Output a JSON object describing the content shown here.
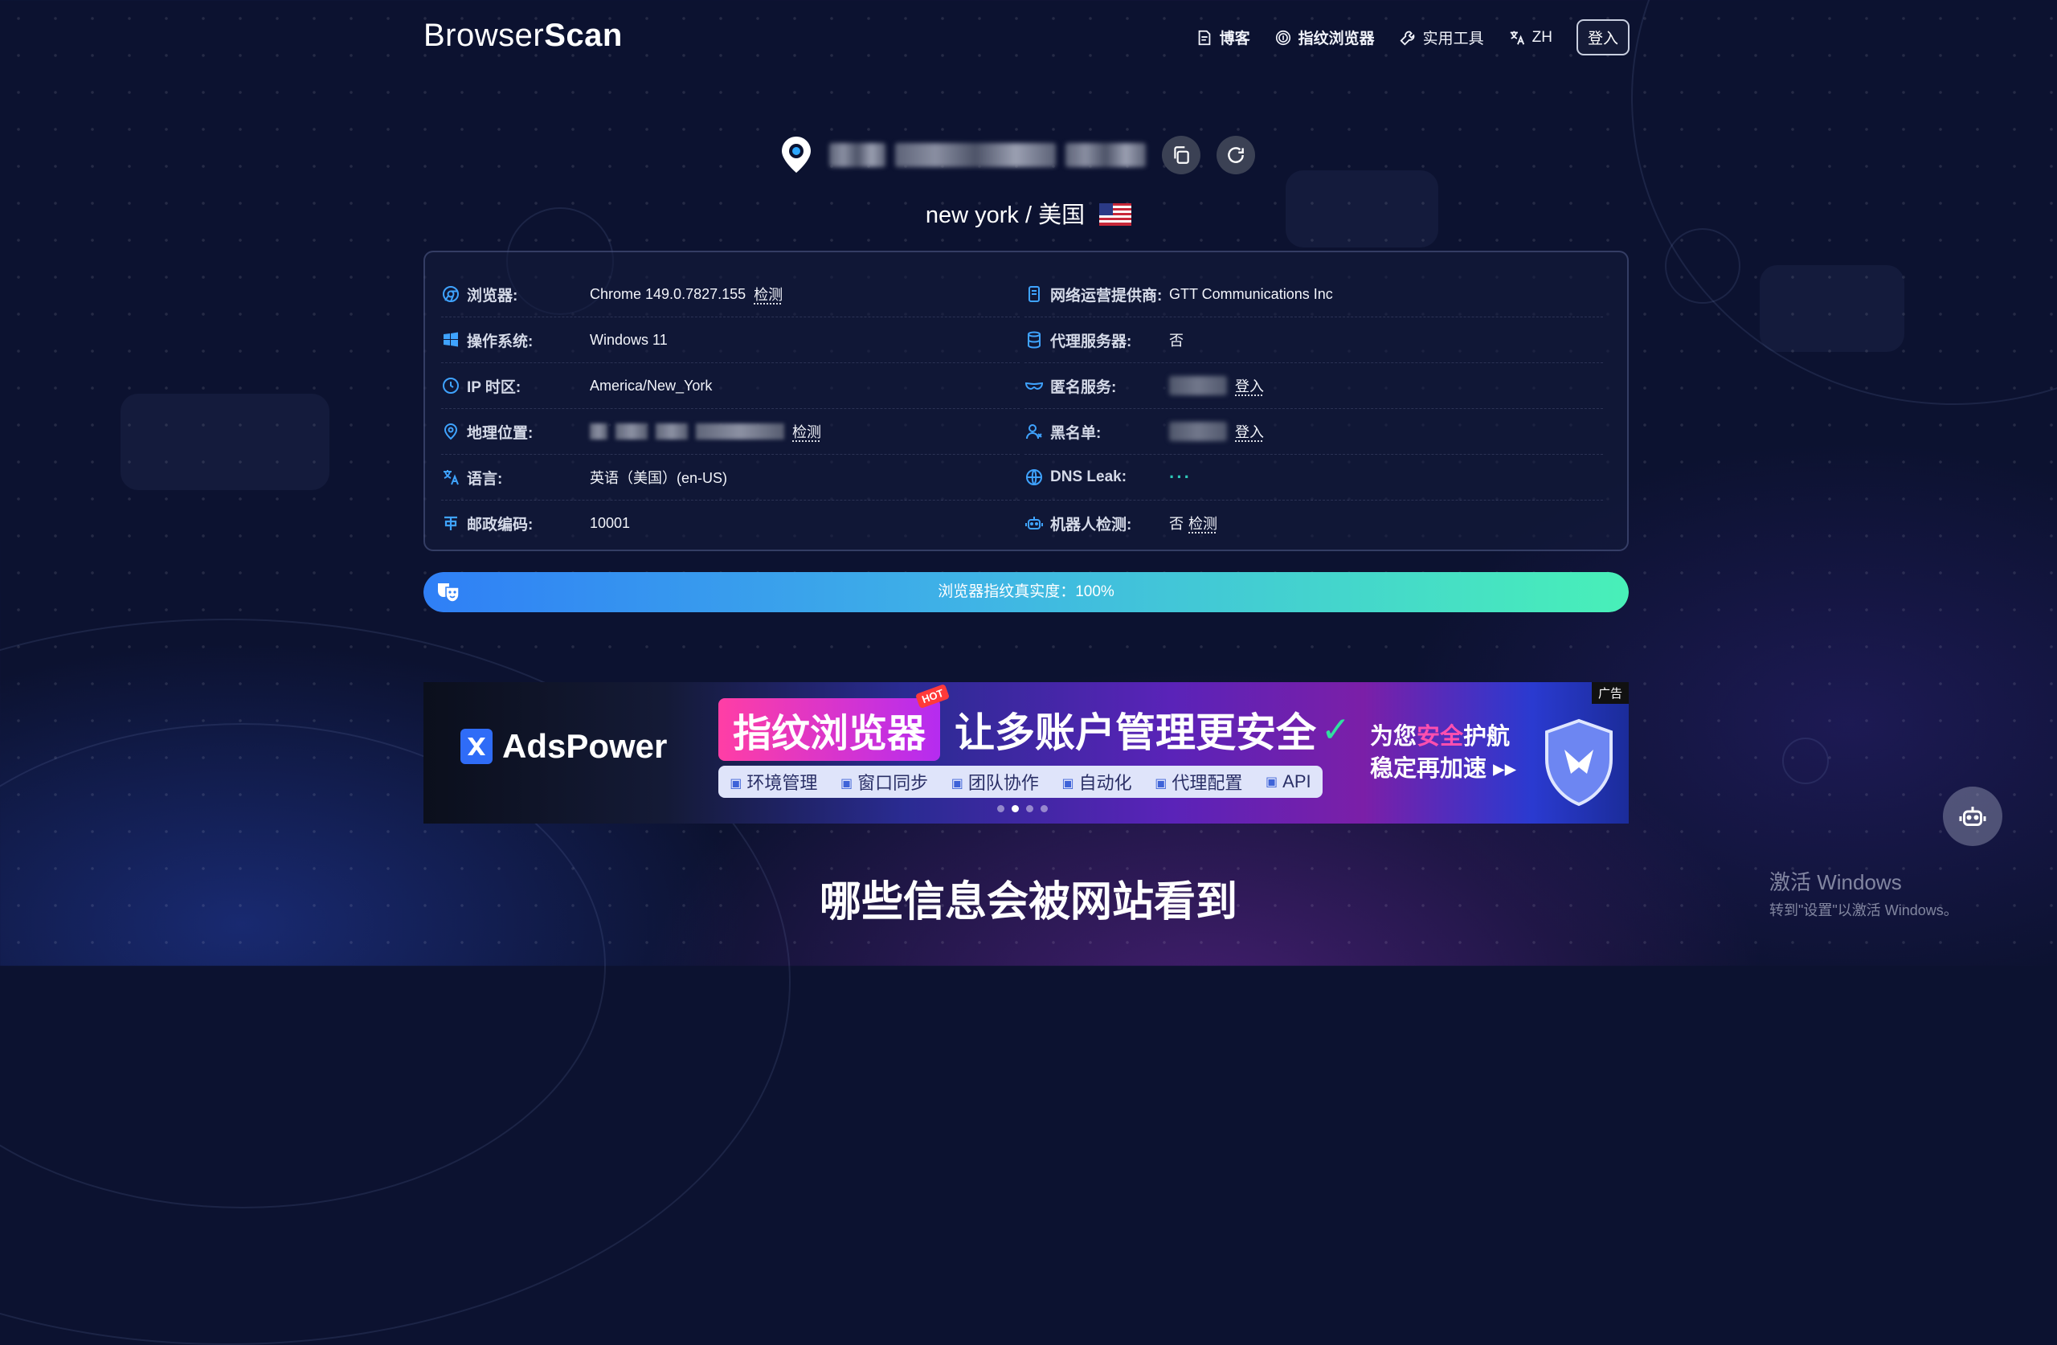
{
  "header": {
    "logo": {
      "part1": "Browser",
      "part2": "Scan"
    },
    "nav": [
      {
        "label": "博客"
      },
      {
        "label": "指纹浏览器"
      },
      {
        "label": "实用工具"
      },
      {
        "label": "ZH"
      }
    ],
    "login_label": "登入"
  },
  "ip": {
    "location": "new york / 美国"
  },
  "info": {
    "left": [
      {
        "label": "浏览器:",
        "value": "Chrome 149.0.7827.155",
        "link": "检测"
      },
      {
        "label": "操作系统:",
        "value": "Windows 11"
      },
      {
        "label": "IP 时区:",
        "value": "America/New_York"
      },
      {
        "label": "地理位置:",
        "link": "检测"
      },
      {
        "label": "语言:",
        "value": "英语（美国）(en-US)"
      },
      {
        "label": "邮政编码:",
        "value": "10001"
      }
    ],
    "right": [
      {
        "label": "网络运营提供商:",
        "value": "GTT Communications Inc"
      },
      {
        "label": "代理服务器:",
        "value": "否"
      },
      {
        "label": "匿名服务:",
        "link": "登入"
      },
      {
        "label": "黑名单:",
        "link": "登入"
      },
      {
        "label": "DNS Leak:",
        "value": "···"
      },
      {
        "label": "机器人检测:",
        "value": "否",
        "link": "检测"
      }
    ]
  },
  "progress": {
    "label": "浏览器指纹真实度：100%",
    "value_percent": 100
  },
  "ad": {
    "tag": "广告",
    "brand": "AdsPower",
    "pill": "指纹浏览器",
    "hot": "HOT",
    "headline": "让多账户管理更安全",
    "features": [
      "环境管理",
      "窗口同步",
      "团队协作",
      "自动化",
      "代理配置",
      "API"
    ],
    "side_prefix": "为您",
    "side_em": "安全",
    "side_suffix": "护航",
    "side_line2": "稳定再加速 ▸▸",
    "slides": 4,
    "active_slide": 2
  },
  "section_title": "哪些信息会被网站看到",
  "watermark": {
    "line1": "激活 Windows",
    "line2": "转到\"设置\"以激活 Windows。"
  },
  "colors": {
    "background": "#0c1230",
    "accent": "#2f7ff6",
    "progress_end": "#48f0b8",
    "icon_blue": "#3fa3ff"
  }
}
